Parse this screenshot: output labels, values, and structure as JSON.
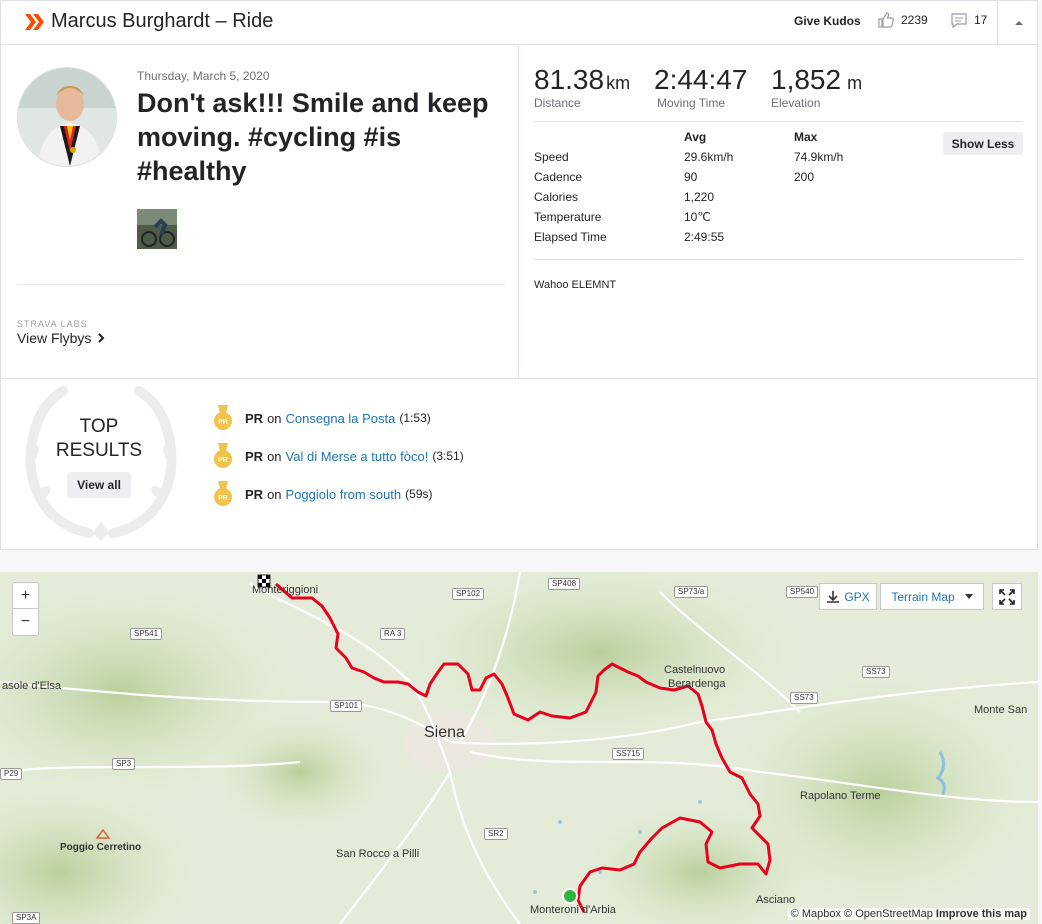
{
  "header": {
    "athlete_activity": "Marcus Burghardt – Ride",
    "give_kudos": "Give Kudos",
    "kudos_count": "2239",
    "comment_count": "17",
    "icons": [
      "strava-chevron-icon",
      "thumbs-up-icon",
      "comment-icon",
      "caret-up-icon"
    ],
    "accent": "#fc4c02"
  },
  "activity": {
    "date": "Thursday, March 5, 2020",
    "title": "Don't ask!!! Smile and keep moving. #cycling #is #healthy",
    "labs": "STRAVA LABS",
    "flybys": "View Flybys"
  },
  "stats": {
    "distance_value": "81.38",
    "distance_unit": "km",
    "distance_label": "Distance",
    "moving_value": "2:44:47",
    "moving_label": "Moving Time",
    "elev_value": "1,852",
    "elev_unit": "m",
    "elev_label": "Elevation",
    "show_less": "Show Less",
    "headers": {
      "avg": "Avg",
      "max": "Max"
    },
    "rows": [
      {
        "label": "Speed",
        "avg": "29.6km/h",
        "max": "74.9km/h"
      },
      {
        "label": "Cadence",
        "avg": "90",
        "max": "200"
      },
      {
        "label": "Calories",
        "avg": "1,220",
        "max": ""
      },
      {
        "label": "Temperature",
        "avg": "10℃",
        "max": ""
      },
      {
        "label": "Elapsed Time",
        "avg": "2:49:55",
        "max": ""
      }
    ],
    "device": "Wahoo ELEMNT"
  },
  "results": {
    "top": "TOP",
    "results": "RESULTS",
    "view_all": "View all",
    "items": [
      {
        "badge": "PR",
        "on": "on",
        "segment": "Consegna la Posta",
        "time": "(1:53)"
      },
      {
        "badge": "PR",
        "on": "on",
        "segment": "Val di Merse a tutto fòco!",
        "time": "(3:51)"
      },
      {
        "badge": "PR",
        "on": "on",
        "segment": "Poggiolo from south",
        "time": "(59s)"
      }
    ]
  },
  "map": {
    "zoom_in": "+",
    "zoom_out": "−",
    "gpx": "GPX",
    "map_type": "Terrain Map",
    "places": [
      "Monteriggioni",
      "Siena",
      "Castelnuovo",
      "Berardenga",
      "Rapolano Terme",
      "Monte San",
      "asole d'Elsa",
      "Poggio Cerretino",
      "San Rocco a Pilli",
      "Asciano",
      "Monteroni d'Arbia"
    ],
    "roads": [
      "SP102",
      "SP408",
      "SP73/a",
      "SP540",
      "SS73",
      "SP541",
      "RA 3",
      "SP101",
      "SS715",
      "SS73",
      "SP3",
      "P29",
      "SR2",
      "SP3A"
    ],
    "credit_mapbox": "© Mapbox",
    "credit_osm": "© OpenStreetMap",
    "credit_improve": "Improve this map",
    "route_color": "#e8001c"
  }
}
